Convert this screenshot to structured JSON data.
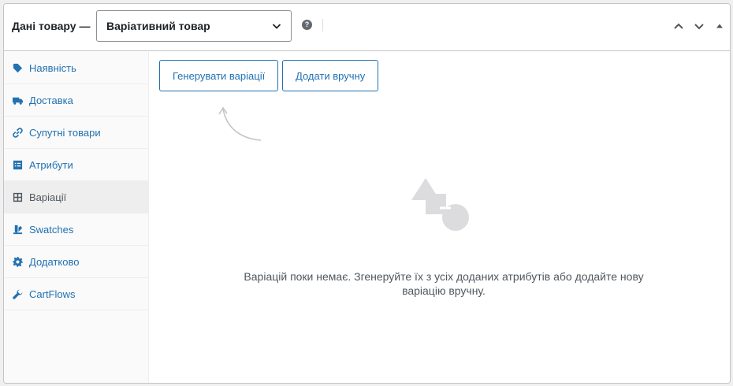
{
  "header": {
    "title": "Дані товару —",
    "product_type": "Варіативний товар",
    "help": "?"
  },
  "sidebar": {
    "items": [
      {
        "label": "Наявність",
        "icon": "tag-icon"
      },
      {
        "label": "Доставка",
        "icon": "truck-icon"
      },
      {
        "label": "Супутні товари",
        "icon": "link-icon"
      },
      {
        "label": "Атрибути",
        "icon": "list-icon"
      },
      {
        "label": "Варіації",
        "icon": "grid-icon",
        "active": true
      },
      {
        "label": "Swatches",
        "icon": "swatches-icon"
      },
      {
        "label": "Додатково",
        "icon": "gear-icon"
      },
      {
        "label": "CartFlows",
        "icon": "wrench-icon"
      }
    ]
  },
  "variations": {
    "generate_label": "Генерувати варіації",
    "add_manual_label": "Додати вручну",
    "empty_line1": "Варіацій поки немає. Згенеруйте їх з усіх доданих атрибутів або додайте нову",
    "empty_line2": "варіацію вручну."
  },
  "colors": {
    "accent": "#2271b1",
    "border": "#c3c4c7",
    "illustration": "#dcdcde"
  }
}
